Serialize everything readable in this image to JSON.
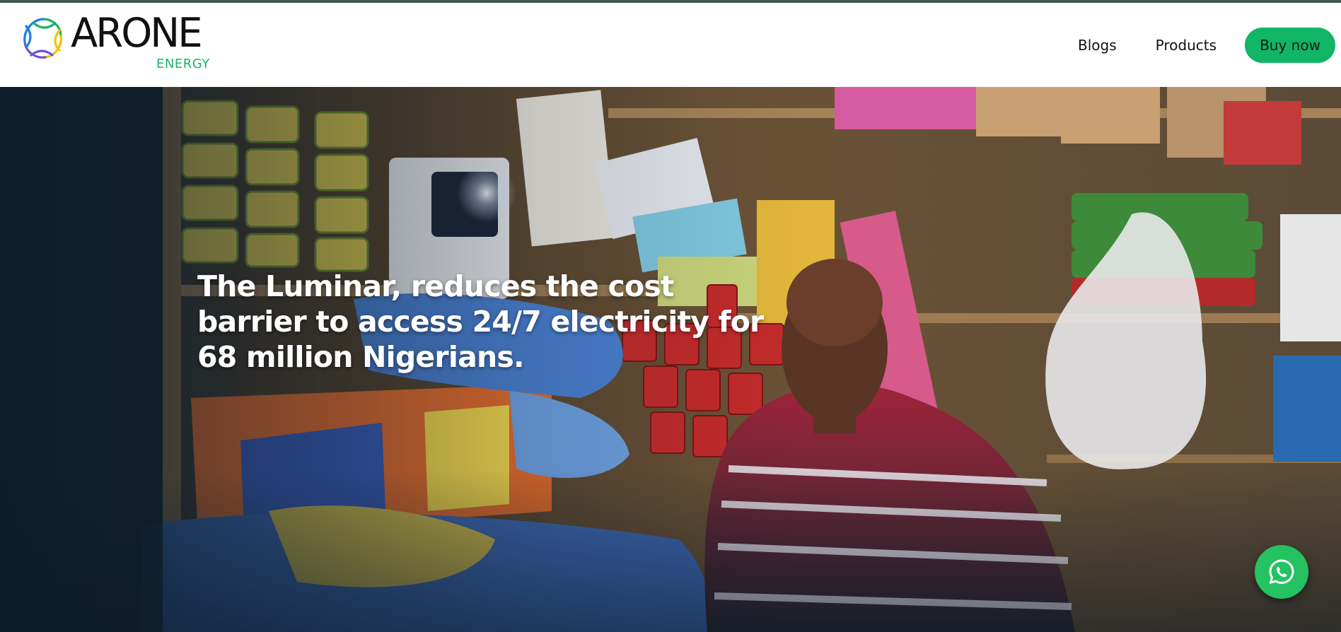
{
  "brand": {
    "name": "ARONE",
    "tagline": "ENERGY",
    "accent_color": "#10b565"
  },
  "nav": {
    "blogs_label": "Blogs",
    "products_label": "Products",
    "buy_label": "Buy now"
  },
  "hero": {
    "headline": "The Luminar, reduces the cost barrier to access 24/7 electricity for 68 million Nigerians.",
    "image_icon": "shop-owner-photo"
  },
  "chat": {
    "icon": "whatsapp-icon",
    "color": "#25c262"
  }
}
